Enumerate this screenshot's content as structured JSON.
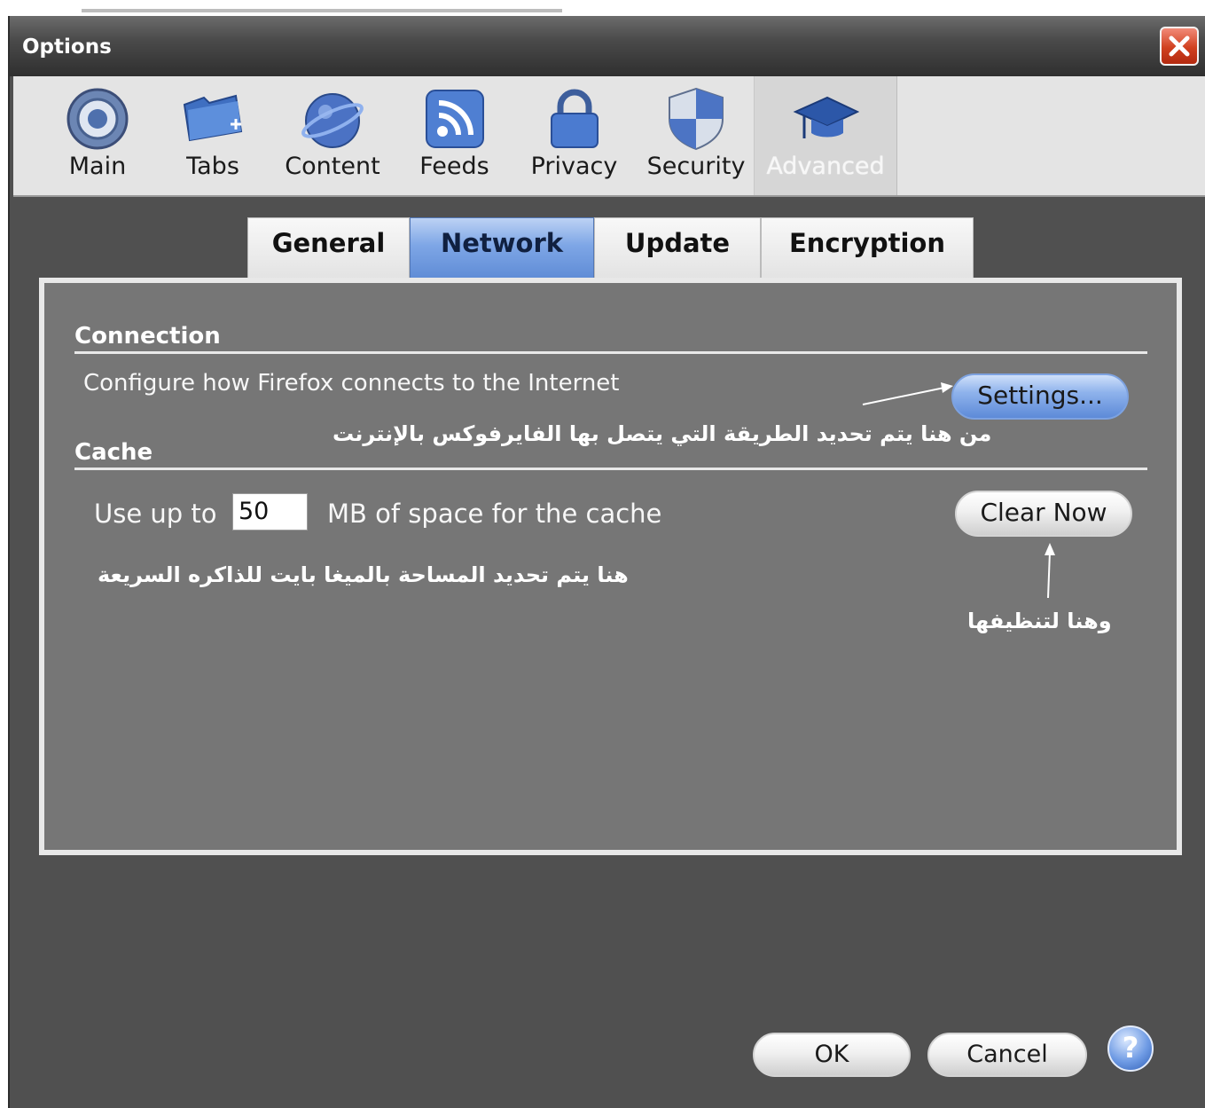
{
  "window": {
    "title": "Options"
  },
  "toolbar": {
    "items": [
      {
        "label": "Main",
        "icon": "main-gear-icon"
      },
      {
        "label": "Tabs",
        "icon": "tabs-folder-icon"
      },
      {
        "label": "Content",
        "icon": "content-globe-icon"
      },
      {
        "label": "Feeds",
        "icon": "feeds-rss-icon"
      },
      {
        "label": "Privacy",
        "icon": "privacy-lock-icon"
      },
      {
        "label": "Security",
        "icon": "security-shield-icon"
      },
      {
        "label": "Advanced",
        "icon": "advanced-hat-icon"
      }
    ],
    "selected": "Advanced"
  },
  "subtabs": {
    "items": [
      "General",
      "Network",
      "Update",
      "Encryption"
    ],
    "selected": "Network"
  },
  "connection": {
    "heading": "Connection",
    "description": "Configure how Firefox connects to the Internet",
    "settings_button": "Settings...",
    "annotation": "من هنا يتم تحديد الطريقة التي يتصل بها الفايرفوكس بالإنترنت"
  },
  "cache": {
    "heading": "Cache",
    "use_up_to_label": "Use up to",
    "size_value": "50",
    "size_suffix": "MB of space for the cache",
    "clear_button": "Clear Now",
    "annotation_size": "هنا يتم تحديد المساحة بالميغا بايت للذاكره السريعة",
    "annotation_clear": "وهنا لتنظيفها"
  },
  "footer": {
    "ok_button": "OK",
    "cancel_button": "Cancel",
    "help_symbol": "?"
  },
  "colors": {
    "selected_tab": "#7ea6e6",
    "panel_bg": "#767676",
    "window_bg": "#505050",
    "close_button": "#d0401f"
  }
}
